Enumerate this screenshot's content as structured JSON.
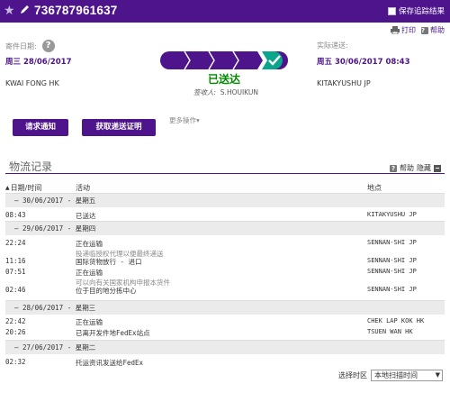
{
  "header": {
    "tracking_number": "736787961637",
    "save_label": "保存追踪结果",
    "star_icon": "star-icon",
    "edit_icon": "pencil-icon"
  },
  "top_links": {
    "print": "打印",
    "help": "帮助"
  },
  "shipment": {
    "ship_date_label": "寄件日期:",
    "ship_date": "周三 28/06/2017",
    "origin": "KWAI FONG HK",
    "actual_delivery_label": "实际递送:",
    "actual_delivery": "周五 30/06/2017 08:43",
    "destination": "KITAKYUSHU JP",
    "status": "已送达",
    "signed_by_label": "签收人:",
    "signed_by": "S.HOUIKUN",
    "progress_steps_total": 5,
    "progress_steps_done": 5
  },
  "actions": {
    "request_notification": "请求通知",
    "get_proof": "获取递送证明",
    "more_actions": "更多操作▾"
  },
  "history": {
    "title": "物流记录",
    "help": "帮助",
    "hide": "隐藏",
    "columns": {
      "date": "日期/时间",
      "activity": "活动",
      "location": "地点"
    },
    "groups": [
      {
        "date": "—  30/06/2017 - 星期五",
        "events": [
          {
            "time": "08:43",
            "activity": "已送达",
            "sub": "",
            "location": "KITAKYUSHU JP"
          }
        ]
      },
      {
        "date": "—  29/06/2017 - 星期四",
        "events": [
          {
            "time": "22:24",
            "activity": "正在运输",
            "sub": "投递临授权代理以便最终递送",
            "location": "SENNAN-SHI JP"
          },
          {
            "time": "11:16",
            "activity": "国际货物放行 - 进口",
            "sub": "",
            "location": "SENNAN-SHI JP"
          },
          {
            "time": "07:51",
            "activity": "正在运输",
            "sub": "可以向有关国家机构申报本货件",
            "location": "SENNAN-SHI JP"
          },
          {
            "time": "02:46",
            "activity": "位于目的地分拣中心",
            "sub": "",
            "location": "SENNAN-SHI JP"
          }
        ]
      },
      {
        "date": "—  28/06/2017 - 星期三",
        "events": [
          {
            "time": "22:42",
            "activity": "正在运输",
            "sub": "",
            "location": "CHEK LAP KOK HK"
          },
          {
            "time": "20:26",
            "activity": "已离开发件地FedEx站点",
            "sub": "",
            "location": "TSUEN WAN HK"
          }
        ]
      },
      {
        "date": "—  27/06/2017 - 星期二",
        "events": [
          {
            "time": "02:32",
            "activity": "托运资讯发送给FedEx",
            "sub": "",
            "location": ""
          }
        ]
      }
    ]
  },
  "timezone": {
    "label": "选择时区",
    "value": "本地扫描时间"
  },
  "colors": {
    "brand_purple": "#4d148c",
    "delivered_green": "#008a00"
  }
}
